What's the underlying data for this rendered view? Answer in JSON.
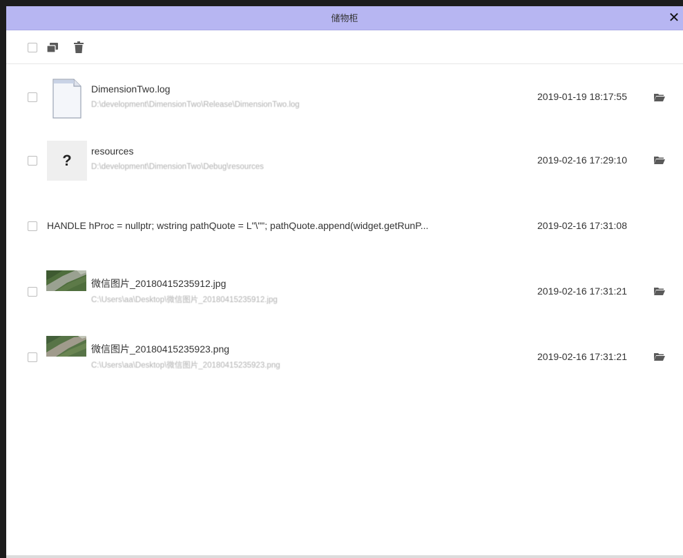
{
  "window": {
    "title": "储物柜",
    "close_label": "✕"
  },
  "toolbar": {
    "icons": [
      "select-all-checkbox",
      "copy-icon",
      "trash-icon"
    ]
  },
  "items": [
    {
      "type": "file",
      "icon": "document-icon",
      "name": "DimensionTwo.log",
      "path": "D:\\development\\DimensionTwo\\Release\\DimensionTwo.log",
      "time": "2019-01-19 18:17:55",
      "has_folder": true
    },
    {
      "type": "unknown",
      "icon": "question-icon",
      "icon_glyph": "?",
      "name": "resources",
      "path": "D:\\development\\DimensionTwo\\Debug\\resources",
      "time": "2019-02-16 17:29:10",
      "has_folder": true
    },
    {
      "type": "text",
      "text": "HANDLE hProc = nullptr; wstring pathQuote = L\"\\\"\"; pathQuote.append(widget.getRunP...",
      "time": "2019-02-16 17:31:08",
      "has_folder": false
    },
    {
      "type": "image",
      "icon": "image-thumbnail",
      "name": "微信图片_20180415235912.jpg",
      "path": "C:\\Users\\aa\\Desktop\\微信图片_20180415235912.jpg",
      "time": "2019-02-16 17:31:21",
      "has_folder": true
    },
    {
      "type": "image",
      "icon": "image-thumbnail",
      "name": "微信图片_20180415235923.png",
      "path": "C:\\Users\\aa\\Desktop\\微信图片_20180415235923.png",
      "time": "2019-02-16 17:31:21",
      "has_folder": true
    }
  ],
  "colors": {
    "title_bar": "#b7b6f2",
    "frame": "#1c1c1c",
    "path_text": "#b0b0b0",
    "icon": "#5a5a5a"
  }
}
